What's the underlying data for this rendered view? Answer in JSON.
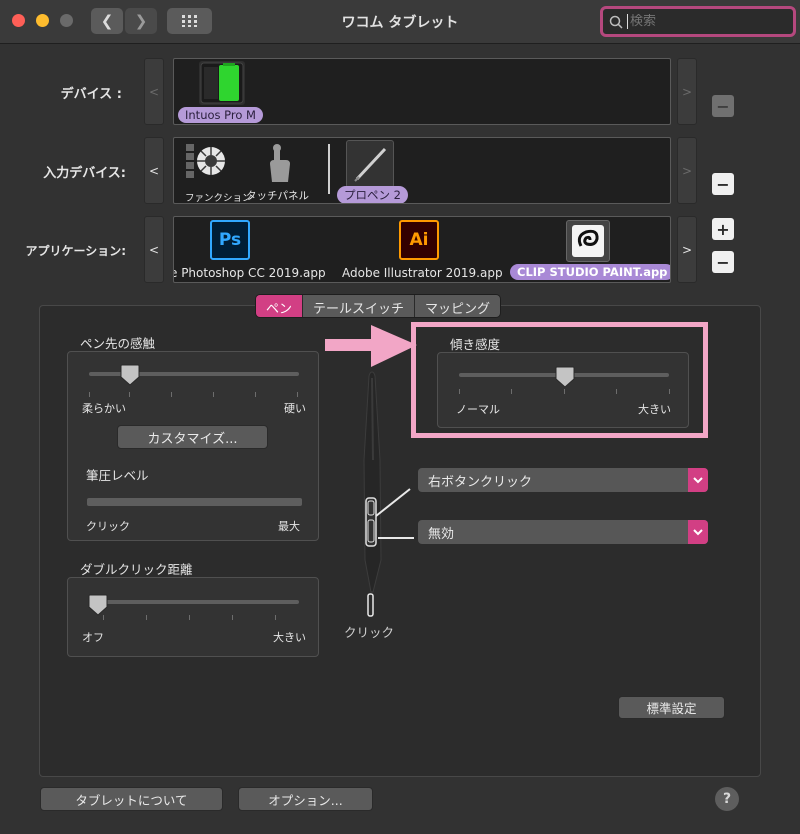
{
  "window": {
    "title": "ワコム タブレット",
    "search_placeholder": "検索"
  },
  "rows": {
    "devices_label": "デバイス :",
    "input_devices_label": "入力デバイス:",
    "applications_label": "アプリケーション:"
  },
  "devices": [
    {
      "name": "Intuos Pro M",
      "selected": true,
      "icon": "tablet-icon"
    }
  ],
  "input_devices": [
    {
      "name": "ファンクション",
      "selected": false,
      "icon": "function-icon"
    },
    {
      "name": "タッチパネル",
      "selected": false,
      "icon": "touch-icon"
    },
    {
      "name": "プロペン 2",
      "selected": true,
      "icon": "pen-icon"
    }
  ],
  "applications": [
    {
      "name": "e Photoshop CC 2019.app",
      "icon_text": "Ps",
      "selected": false
    },
    {
      "name": "Adobe Illustrator 2019.app",
      "icon_text": "Ai",
      "selected": false
    },
    {
      "name": "CLIP STUDIO PAINT.app",
      "selected": true,
      "icon": "clip-studio-icon"
    }
  ],
  "tabs": [
    "ペン",
    "テールスイッチ",
    "マッピング"
  ],
  "active_tab": "ペン",
  "pen_feel": {
    "title": "ペン先の感触",
    "left_label": "柔らかい",
    "right_label": "硬い",
    "customize_button": "カスタマイズ...",
    "pressure_title": "筆圧レベル",
    "pressure_left": "クリック",
    "pressure_right": "最大",
    "level_fraction": 0.2
  },
  "double_click": {
    "title": "ダブルクリック距離",
    "left_label": "オフ",
    "right_label": "大きい",
    "level_fraction": 0.0
  },
  "tilt": {
    "title": "傾き感度",
    "left_label": "ノーマル",
    "right_label": "大きい",
    "level_fraction": 0.5
  },
  "side_buttons": {
    "upper": "右ボタンクリック",
    "lower": "無効"
  },
  "tip_label": "クリック",
  "default_button": "標準設定",
  "about_button": "タブレットについて",
  "options_button": "オプション...",
  "help_label": "?",
  "colors": {
    "accent": "#d23f84",
    "highlight": "#f2a6c6",
    "selection": "#b59ad8"
  }
}
